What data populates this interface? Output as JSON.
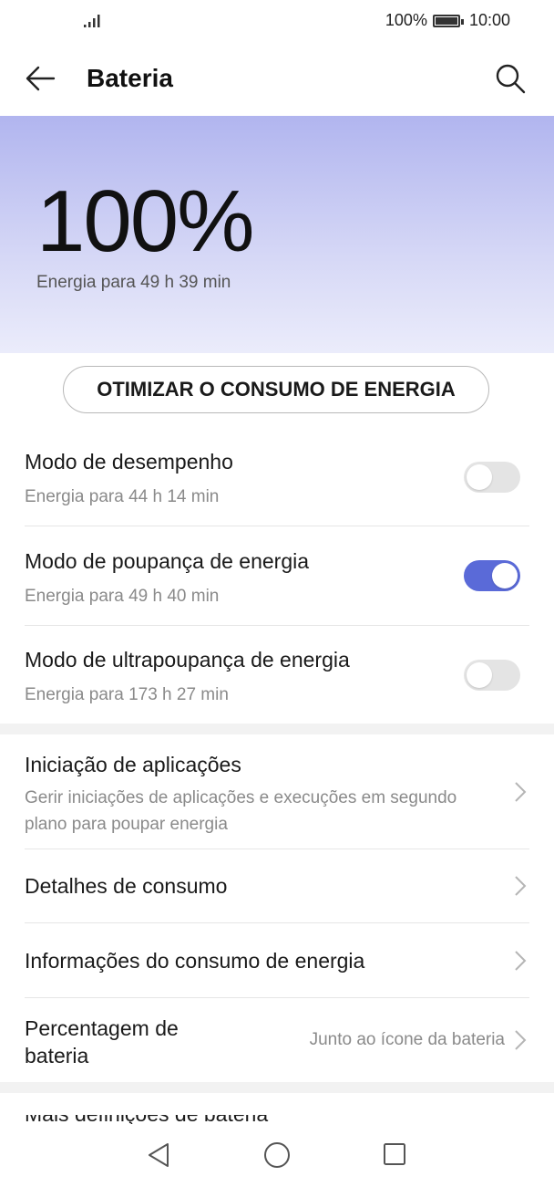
{
  "status": {
    "battery_pct": "100%",
    "time": "10:00"
  },
  "header": {
    "title": "Bateria"
  },
  "hero": {
    "percent": "100%",
    "remaining": "Energia para 49 h 39 min"
  },
  "optimize_button": "OTIMIZAR O CONSUMO DE ENERGIA",
  "modes": [
    {
      "title": "Modo de desempenho",
      "sub": "Energia para 44 h 14 min",
      "enabled": false
    },
    {
      "title": "Modo de poupança de energia",
      "sub": "Energia para 49 h 40 min",
      "enabled": true
    },
    {
      "title": "Modo de ultrapoupança de energia",
      "sub": "Energia para 173 h 27 min",
      "enabled": false
    }
  ],
  "settings": [
    {
      "title": "Iniciação de aplicações",
      "sub": "Gerir iniciações de aplicações e execuções em segundo plano para poupar energia"
    },
    {
      "title": "Detalhes de consumo"
    },
    {
      "title": "Informações do consumo de energia"
    },
    {
      "title": "Percentagem de bateria",
      "value": "Junto ao ícone da bateria"
    }
  ],
  "cut_row": "Mais definições de bateria",
  "colors": {
    "accent": "#5a6ad8",
    "hero_top": "#b1b5ef"
  }
}
